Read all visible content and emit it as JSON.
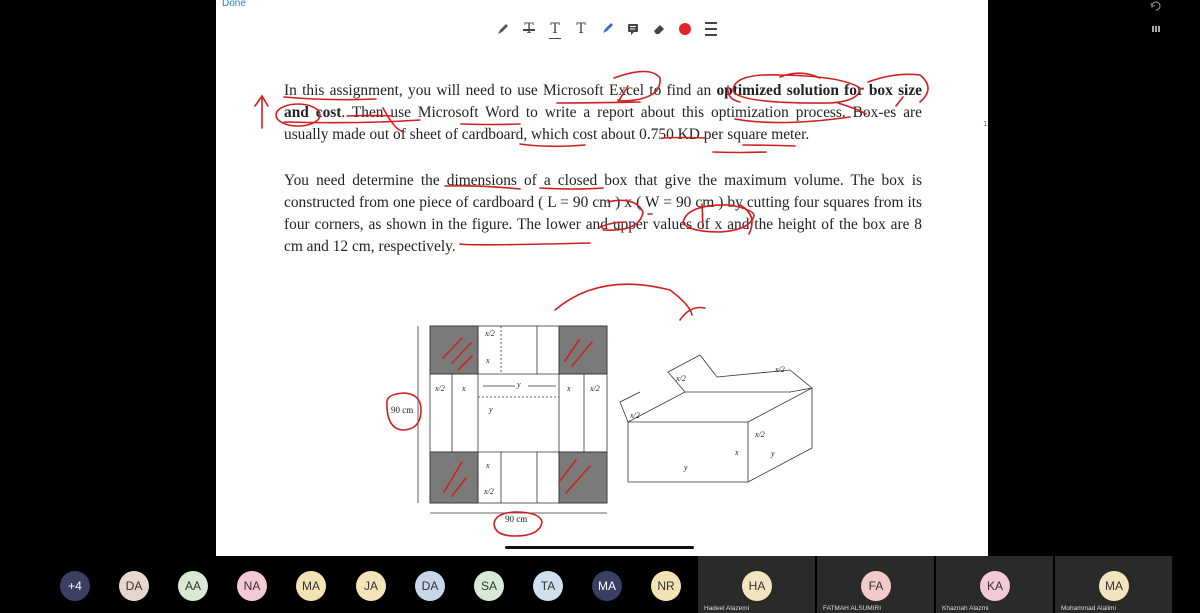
{
  "top_bar": {
    "done_label": "Done"
  },
  "toolbar": {
    "tools": [
      "pen-icon",
      "strikethrough-text-icon",
      "underline-text-icon",
      "text-icon",
      "marker-icon",
      "comment-icon",
      "eraser-icon",
      "record-dot-icon",
      "menu-icon"
    ],
    "record_color": "#e32424"
  },
  "page_number": "1",
  "document": {
    "p1": {
      "a": "In this assignment, you will need to use Microsoft Excel to find an ",
      "b": "optimized solution for box size and cost",
      "c": ". Then use Microsoft Word to write a report about this optimization process. Box-es are usually made out of sheet of cardboard, which cost about 0.750 KD per square meter."
    },
    "p2": "You need determine the dimensions of a closed box that give the maximum volume. The box is constructed from one piece of cardboard ( L = 90 cm ) x ( W = 90 cm ) by cutting four squares from its four corners, as shown in the figure. The lower and upper values of x and the height of the box are 8 cm and 12 cm, respectively."
  },
  "figure": {
    "net_labels": {
      "half_x": "x/2",
      "x": "x",
      "y": "y",
      "side_90": "90 cm",
      "bottom_90": "90 cm"
    },
    "box_labels": {
      "half_x": "x/2",
      "x": "x",
      "y": "y"
    }
  },
  "annotation_color": "#d11f1f",
  "participants": [
    {
      "initials": "+4",
      "color": "#3b3f63",
      "text_color": "#ffffff"
    },
    {
      "initials": "DA",
      "color": "#e6d6cc"
    },
    {
      "initials": "AA",
      "color": "#d8e8d2"
    },
    {
      "initials": "NA",
      "color": "#f4c9d6"
    },
    {
      "initials": "MA",
      "color": "#f1e3b4"
    },
    {
      "initials": "JA",
      "color": "#f2e4b8"
    },
    {
      "initials": "DA",
      "color": "#c8d6ea"
    },
    {
      "initials": "SA",
      "color": "#d6ead6"
    },
    {
      "initials": "TA",
      "color": "#cfe0ec"
    },
    {
      "initials": "MA",
      "color": "#3b3f63",
      "text_color": "#ffffff"
    },
    {
      "initials": "NR",
      "color": "#f1e3b4"
    },
    {
      "initials": "HA",
      "color": "#f2e4bf",
      "name": "Hadeel Alazemi"
    },
    {
      "initials": "FA",
      "color": "#f4c9c9",
      "name": "FATMAH ALSUMIRI"
    },
    {
      "initials": "KA",
      "color": "#f4c9d6",
      "name": "Khaznah Alazmi"
    },
    {
      "initials": "MA",
      "color": "#f2e4bf",
      "name": "Mohammad Alalimi"
    }
  ]
}
